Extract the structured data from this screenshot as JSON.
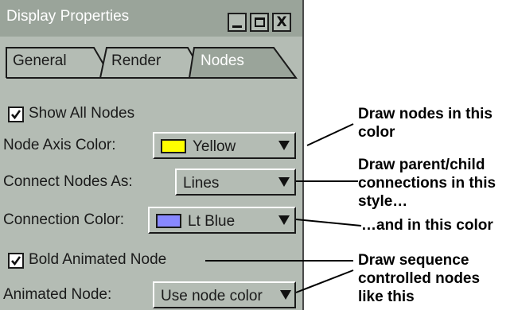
{
  "window": {
    "title": "Display Properties",
    "controls": {
      "minimize": "_",
      "maximize": "□",
      "close": "X"
    }
  },
  "tabs": [
    {
      "label": "General",
      "active": false
    },
    {
      "label": "Render",
      "active": false
    },
    {
      "label": "Nodes",
      "active": true
    }
  ],
  "form": {
    "show_all_nodes": {
      "label": "Show All Nodes",
      "checked": true
    },
    "node_axis_color": {
      "label": "Node Axis Color:",
      "value": "Yellow",
      "swatch": "#ffff00"
    },
    "connect_nodes_as": {
      "label": "Connect Nodes As:",
      "value": "Lines"
    },
    "connection_color": {
      "label": "Connection Color:",
      "value": "Lt Blue",
      "swatch": "#8888ff"
    },
    "bold_animated_node": {
      "label": "Bold Animated Node",
      "checked": true
    },
    "animated_node": {
      "label": "Animated Node:",
      "value": "Use node color"
    }
  },
  "callouts": {
    "node_color": [
      "Draw nodes in this",
      "color"
    ],
    "connection_style": [
      "Draw parent/child",
      "connections in this",
      "style…"
    ],
    "connection_color": [
      "…and in this color"
    ],
    "sequence_nodes": [
      "Draw sequence",
      "controlled nodes",
      "like this"
    ]
  },
  "colors": {
    "panel": "#b4bcb4",
    "titlebar": "#9aa49a",
    "active_tab": "#9aa49a",
    "yellow_swatch": "#ffff00",
    "lt_blue_swatch": "#8888ff"
  }
}
